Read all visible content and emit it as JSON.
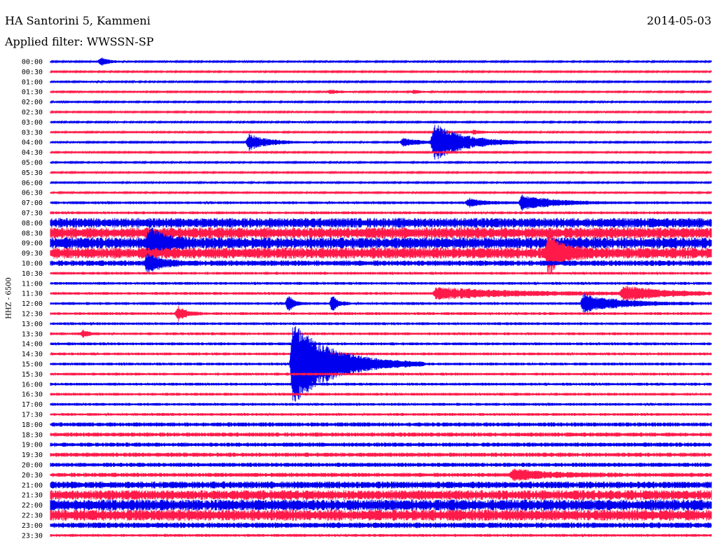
{
  "header": {
    "station": "HA Santorini 5, Kammeni",
    "date": "2014-05-03",
    "filter": "Applied filter: WWSSN-SP"
  },
  "chart_data": {
    "type": "line",
    "title": "HA Santorini 5, Kammeni",
    "ylabel": "HHZ - 6500",
    "trace_labels": [
      "00:00",
      "00:30",
      "01:00",
      "01:30",
      "02:00",
      "02:30",
      "03:00",
      "03:30",
      "04:00",
      "04:30",
      "05:00",
      "05:30",
      "06:00",
      "06:30",
      "07:00",
      "07:30",
      "08:00",
      "08:30",
      "09:00",
      "09:30",
      "10:00",
      "10:30",
      "11:00",
      "11:30",
      "12:00",
      "12:30",
      "13:00",
      "13:30",
      "14:00",
      "14:30",
      "15:00",
      "15:30",
      "16:00",
      "16:30",
      "17:00",
      "17:30",
      "18:00",
      "18:30",
      "19:00",
      "19:30",
      "20:00",
      "20:30",
      "21:00",
      "21:30",
      "22:00",
      "22:30",
      "23:00",
      "23:30"
    ],
    "x_unit": "minutes into trace",
    "x_range": [
      0,
      30
    ],
    "series_colors": [
      "#0000ee",
      "#ff1a4a"
    ],
    "noise_amplitude": [
      1,
      1,
      1,
      1,
      1,
      1,
      1,
      1,
      1,
      1,
      1,
      1,
      1,
      1,
      2,
      2,
      7,
      8,
      8,
      8,
      4,
      2,
      2,
      2,
      2,
      2,
      2,
      2,
      2,
      2,
      2,
      2,
      2,
      2,
      2,
      2,
      3,
      3,
      3,
      3,
      3,
      3,
      5,
      7,
      8,
      8,
      4,
      2
    ],
    "events": [
      {
        "trace": "00:00",
        "x": 2.3,
        "amp": 6,
        "dur": 0.6
      },
      {
        "trace": "01:00",
        "x": 1.5,
        "amp": 1,
        "dur": 1.0
      },
      {
        "trace": "01:30",
        "x": 12.7,
        "amp": 3,
        "dur": 0.8
      },
      {
        "trace": "01:30",
        "x": 16.5,
        "amp": 3,
        "dur": 0.5
      },
      {
        "trace": "03:00",
        "x": 11.0,
        "amp": 1,
        "dur": 0.8
      },
      {
        "trace": "03:30",
        "x": 19.2,
        "amp": 3,
        "dur": 0.8
      },
      {
        "trace": "04:00",
        "x": 9.0,
        "amp": 12,
        "dur": 1.5
      },
      {
        "trace": "04:00",
        "x": 16.0,
        "amp": 6,
        "dur": 1.5
      },
      {
        "trace": "04:00",
        "x": 17.4,
        "amp": 26,
        "dur": 2.5
      },
      {
        "trace": "07:00",
        "x": 21.4,
        "amp": 12,
        "dur": 2.0
      },
      {
        "trace": "07:00",
        "x": 19.0,
        "amp": 6,
        "dur": 1.0
      },
      {
        "trace": "09:00",
        "x": 4.5,
        "amp": 22,
        "dur": 1.0
      },
      {
        "trace": "09:30",
        "x": 22.6,
        "amp": 30,
        "dur": 1.0
      },
      {
        "trace": "10:00",
        "x": 4.4,
        "amp": 14,
        "dur": 1.0
      },
      {
        "trace": "11:30",
        "x": 17.5,
        "amp": 8,
        "dur": 6.0
      },
      {
        "trace": "11:30",
        "x": 26.0,
        "amp": 10,
        "dur": 3.0
      },
      {
        "trace": "12:00",
        "x": 24.2,
        "amp": 14,
        "dur": 2.5
      },
      {
        "trace": "12:00",
        "x": 10.8,
        "amp": 12,
        "dur": 0.4
      },
      {
        "trace": "12:00",
        "x": 12.8,
        "amp": 12,
        "dur": 0.4
      },
      {
        "trace": "12:30",
        "x": 5.8,
        "amp": 10,
        "dur": 0.6
      },
      {
        "trace": "13:30",
        "x": 1.5,
        "amp": 5,
        "dur": 0.4
      },
      {
        "trace": "15:00",
        "x": 11.0,
        "amp": 60,
        "dur": 3.0
      },
      {
        "trace": "20:30",
        "x": 21.0,
        "amp": 8,
        "dur": 2.5
      }
    ]
  }
}
